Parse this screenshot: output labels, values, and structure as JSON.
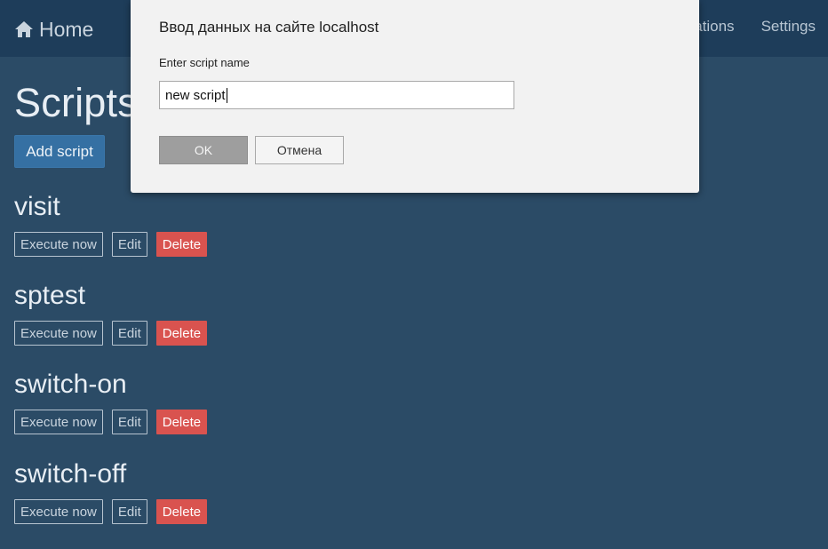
{
  "navbar": {
    "brand_label": "Home",
    "brand_icon": "home-icon",
    "links": [
      "ations",
      "Settings"
    ]
  },
  "page": {
    "title": "Scripts",
    "add_button_label": "Add script"
  },
  "scripts": [
    {
      "name": "visit",
      "execute_label": "Execute now",
      "edit_label": "Edit",
      "delete_label": "Delete"
    },
    {
      "name": "sptest",
      "execute_label": "Execute now",
      "edit_label": "Edit",
      "delete_label": "Delete"
    },
    {
      "name": "switch-on",
      "execute_label": "Execute now",
      "edit_label": "Edit",
      "delete_label": "Delete"
    },
    {
      "name": "switch-off",
      "execute_label": "Execute now",
      "edit_label": "Edit",
      "delete_label": "Delete"
    }
  ],
  "dialog": {
    "title": "Ввод данных на сайте localhost",
    "prompt_label": "Enter script name",
    "input_value": "new script",
    "ok_label": "OK",
    "cancel_label": "Отмена"
  },
  "colors": {
    "background": "#2b4b66",
    "navbar": "#1e3d5a",
    "primary_button": "#3570a3",
    "danger_button": "#d9534f"
  }
}
